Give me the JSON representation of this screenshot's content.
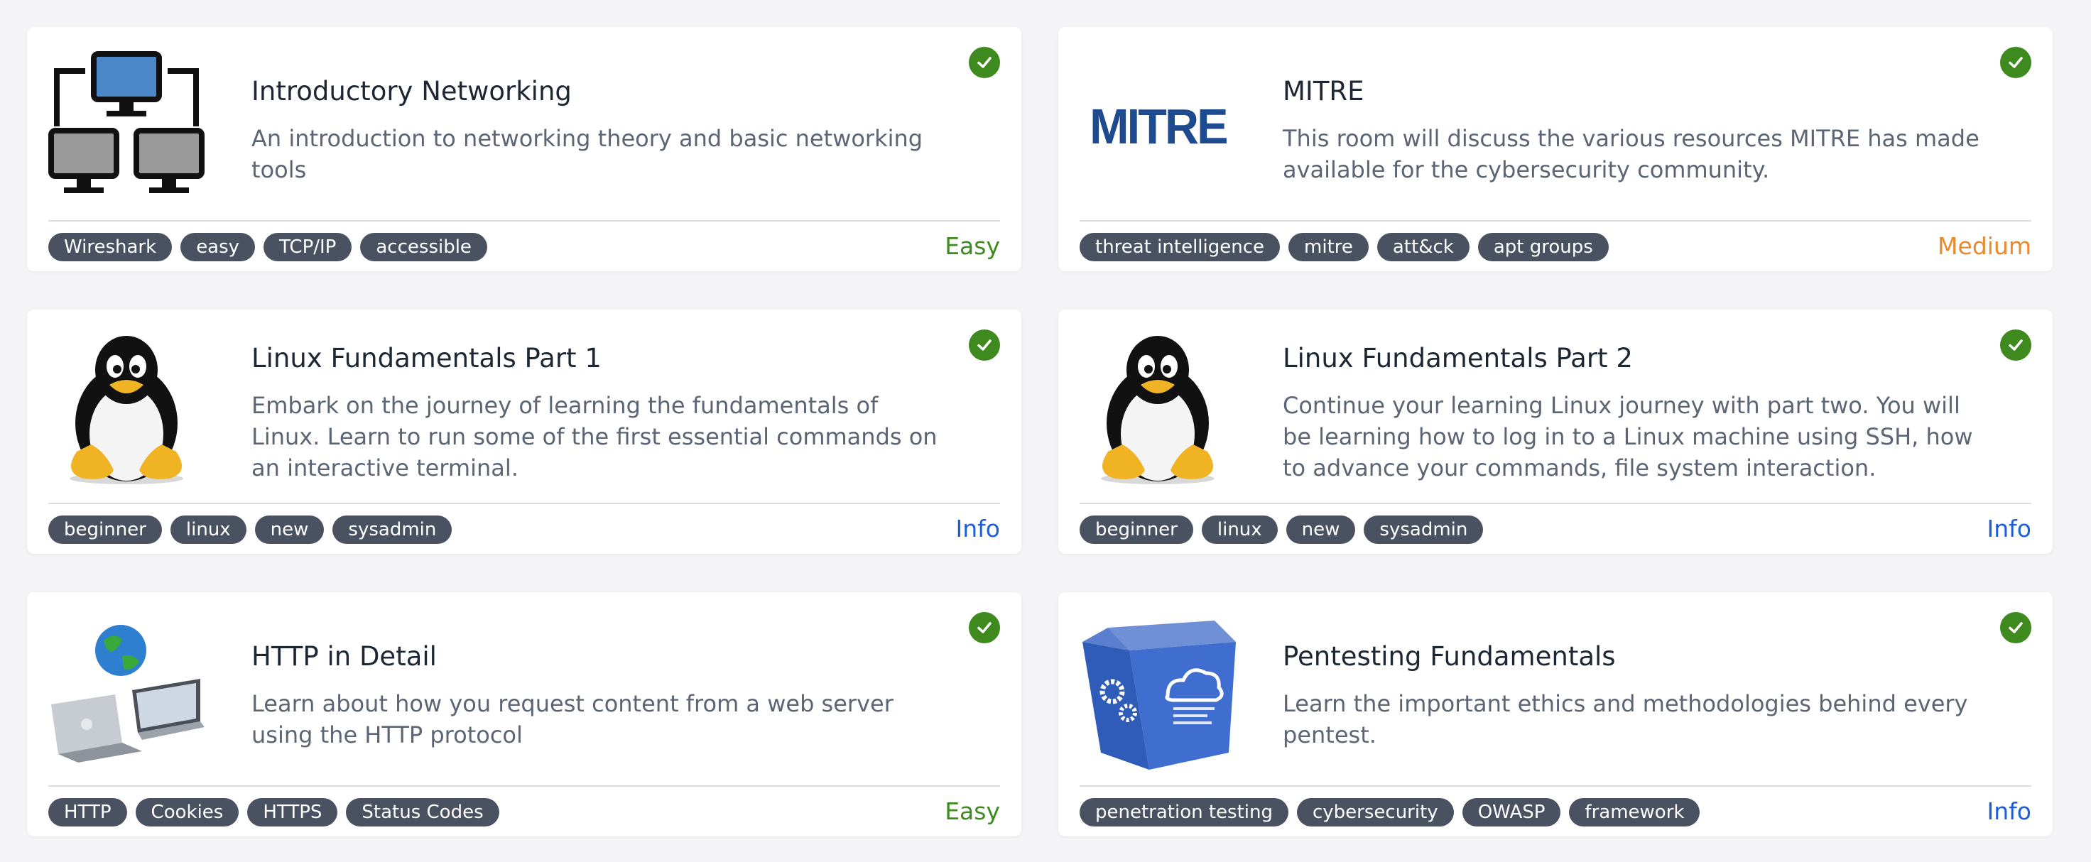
{
  "cards": [
    {
      "title": "Introductory Networking",
      "description": "An introduction to networking theory and basic networking tools",
      "image": "network-computers-icon",
      "completed": true,
      "tags": [
        "Wireshark",
        "easy",
        "TCP/IP",
        "accessible"
      ],
      "difficulty": "Easy",
      "difficulty_color": "#3f8a1f"
    },
    {
      "title": "MITRE",
      "description": "This room will discuss the various resources MITRE has made available for the cybersecurity community.",
      "image": "mitre-logo",
      "logo_text": "MITRE",
      "completed": true,
      "tags": [
        "threat intelligence",
        "mitre",
        "att&ck",
        "apt groups"
      ],
      "difficulty": "Medium",
      "difficulty_color": "#ea8a2f"
    },
    {
      "title": "Linux Fundamentals Part 1",
      "description": "Embark on the journey of learning the fundamentals of Linux. Learn to run some of the first essential commands on an interactive terminal.",
      "image": "linux-penguin-icon",
      "completed": true,
      "tags": [
        "beginner",
        "linux",
        "new",
        "sysadmin"
      ],
      "difficulty": "Info",
      "difficulty_color": "#1f5fd6"
    },
    {
      "title": "Linux Fundamentals Part 2",
      "description": "Continue your learning Linux journey with part two. You will be learning how to log in to a Linux machine using SSH, how to advance your commands, file system interaction.",
      "image": "linux-penguin-icon",
      "completed": true,
      "tags": [
        "beginner",
        "linux",
        "new",
        "sysadmin"
      ],
      "difficulty": "Info",
      "difficulty_color": "#1f5fd6"
    },
    {
      "title": "HTTP in Detail",
      "description": "Learn about how you request content from a web server using the HTTP protocol",
      "image": "laptops-globe-icon",
      "completed": true,
      "tags": [
        "HTTP",
        "Cookies",
        "HTTPS",
        "Status Codes"
      ],
      "difficulty": "Easy",
      "difficulty_color": "#3f8a1f"
    },
    {
      "title": "Pentesting Fundamentals",
      "description": "Learn the important ethics and methodologies behind every pentest.",
      "image": "cloud-cube-icon",
      "completed": true,
      "tags": [
        "penetration testing",
        "cybersecurity",
        "OWASP",
        "framework"
      ],
      "difficulty": "Info",
      "difficulty_color": "#1f5fd6"
    }
  ]
}
